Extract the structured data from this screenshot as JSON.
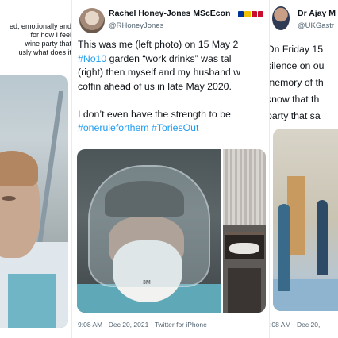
{
  "left_tweet": {
    "text_lines": [
      "ed, emotionally and",
      "for how I feel",
      "wine party that",
      "usly what does it"
    ]
  },
  "center_tweet": {
    "display_name": "Rachel Honey-Jones MScEcon",
    "handle": "@RHoneyJones",
    "body_lines": [
      "This was me (left photo) on 15 May 2",
      "#No10 garden “work drinks” was tal",
      "(right) then myself and my husband w",
      "coffin ahead of us in late May 2020.",
      "",
      "I don’t even have the strength to be"
    ],
    "hashtag_prefix": "#No10",
    "hashtag_line": "#oneruleforthem #ToriesOut",
    "photo_mask_text": "3M",
    "timestamp": "9:08 AM · Dec 20, 2021 · Twitter for iPhone",
    "flag_colors": [
      "#003399",
      "#f2c200",
      "#c8102e",
      "#c8102e",
      "#00843d"
    ]
  },
  "right_tweet": {
    "display_name": "Dr Ajay M",
    "handle": "@UKGastr",
    "body_lines": [
      "On Friday 15",
      "silence on ou",
      "memory of th",
      "know that th",
      "party that sa"
    ],
    "timestamp": ":08 AM · Dec 20,"
  },
  "colors": {
    "link": "#1d9bf0",
    "secondary_text": "#536471",
    "text": "#0f1419"
  }
}
